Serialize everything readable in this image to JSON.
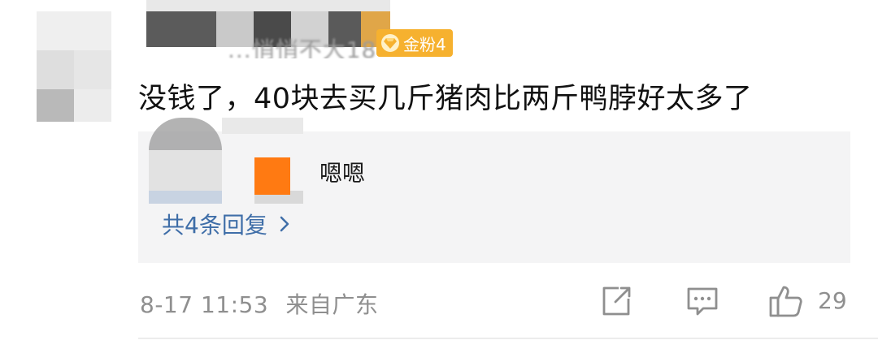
{
  "author": {
    "name": "...悄悄不大18",
    "fan_badge": "金粉4",
    "badge_color": "#f6b12f"
  },
  "comment": {
    "text": "没钱了，40块去买几斤猪肉比两斤鸭脖好太多了"
  },
  "replies": {
    "preview_text": "嗯嗯",
    "more_label": "共4条回复",
    "more_icon": "chevron-right-icon",
    "link_color": "#3f6ea8"
  },
  "footer": {
    "timestamp": "8-17 11:53",
    "location": "来自广东",
    "share_icon": "share-icon",
    "reply_icon": "comment-icon",
    "like_icon": "thumbs-up-icon",
    "like_count": "29"
  }
}
